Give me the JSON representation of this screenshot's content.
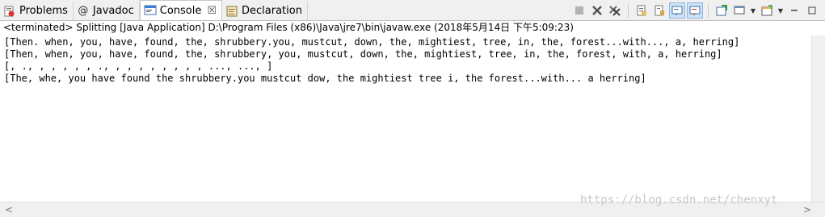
{
  "tabs": [
    {
      "label": "Problems",
      "icon": "problems-icon"
    },
    {
      "label": "Javadoc",
      "icon": "javadoc-at-icon"
    },
    {
      "label": "Console",
      "icon": "console-icon",
      "close": "☒"
    },
    {
      "label": "Declaration",
      "icon": "declaration-icon"
    }
  ],
  "javadoc_glyph": "@",
  "status_text": "<terminated> Splitting [Java Application] D:\\Program Files (x86)\\Java\\jre7\\bin\\javaw.exe (2018年5月14日 下午5:09:23)",
  "console_lines": [
    "[Then. when, you, have, found, the, shrubbery.you, mustcut, down, the, mightiest, tree, in, the, forest...with..., a, herring]",
    "[Then, when, you, have, found, the, shrubbery, you, mustcut, down, the, mightiest, tree, in, the, forest, with, a, herring]",
    "[, ., , , , , , ., , , , , , , , , ..., ..., ]",
    "[The, whe, you have found the shrubbery.you mustcut dow, the mightiest tree i, the forest...with... a herring]"
  ],
  "watermark": "https://blog.csdn.net/chenxyt",
  "scroll_arrows": {
    "left": "<",
    "right": ">"
  },
  "colors": {
    "accent": "#3d7fd0",
    "stop_red": "#b0b0b0"
  }
}
